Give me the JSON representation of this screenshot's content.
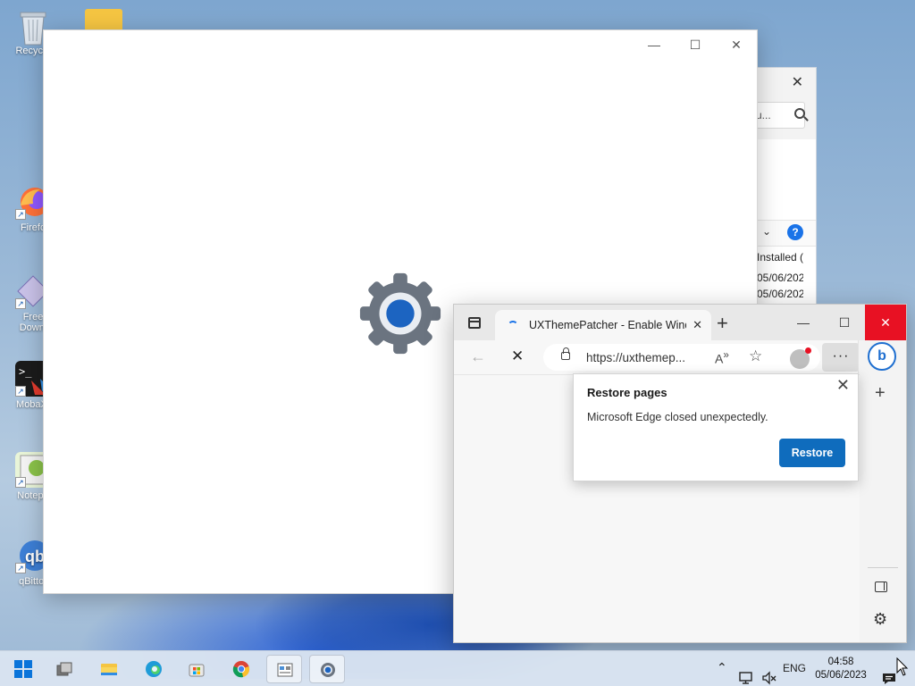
{
  "desktop": {
    "icons": [
      {
        "label": "Recycle",
        "icon": "recycle-bin-icon"
      },
      {
        "label": "Firefo",
        "icon": "firefox-icon"
      },
      {
        "label": "Free\nDownl",
        "icon": "free-download-manager-icon"
      },
      {
        "label": "MobaXt",
        "icon": "mobaxterm-icon"
      },
      {
        "label": "Notepa",
        "icon": "notepad-plus-plus-icon"
      },
      {
        "label": "qBittor",
        "icon": "qbittorrent-icon"
      }
    ]
  },
  "back_window": {
    "search_text": "u...",
    "column_header": "Installed (",
    "rows": [
      "05/06/202",
      "05/06/202"
    ]
  },
  "settings_window": {
    "controls": {
      "minimize": "—",
      "maximize": "☐",
      "close": "✕"
    }
  },
  "edge": {
    "tab_title": "UXThemePatcher - Enable Windo",
    "url": "https://uxthemep...",
    "restore_popup": {
      "title": "Restore pages",
      "message": "Microsoft Edge closed unexpectedly.",
      "button": "Restore"
    }
  },
  "taskbar": {
    "language": "ENG",
    "time": "04:58",
    "date": "05/06/2023"
  },
  "colors": {
    "accent": "#0f6cbd",
    "close_red": "#e81123",
    "windows_blue": "#0a74da"
  }
}
